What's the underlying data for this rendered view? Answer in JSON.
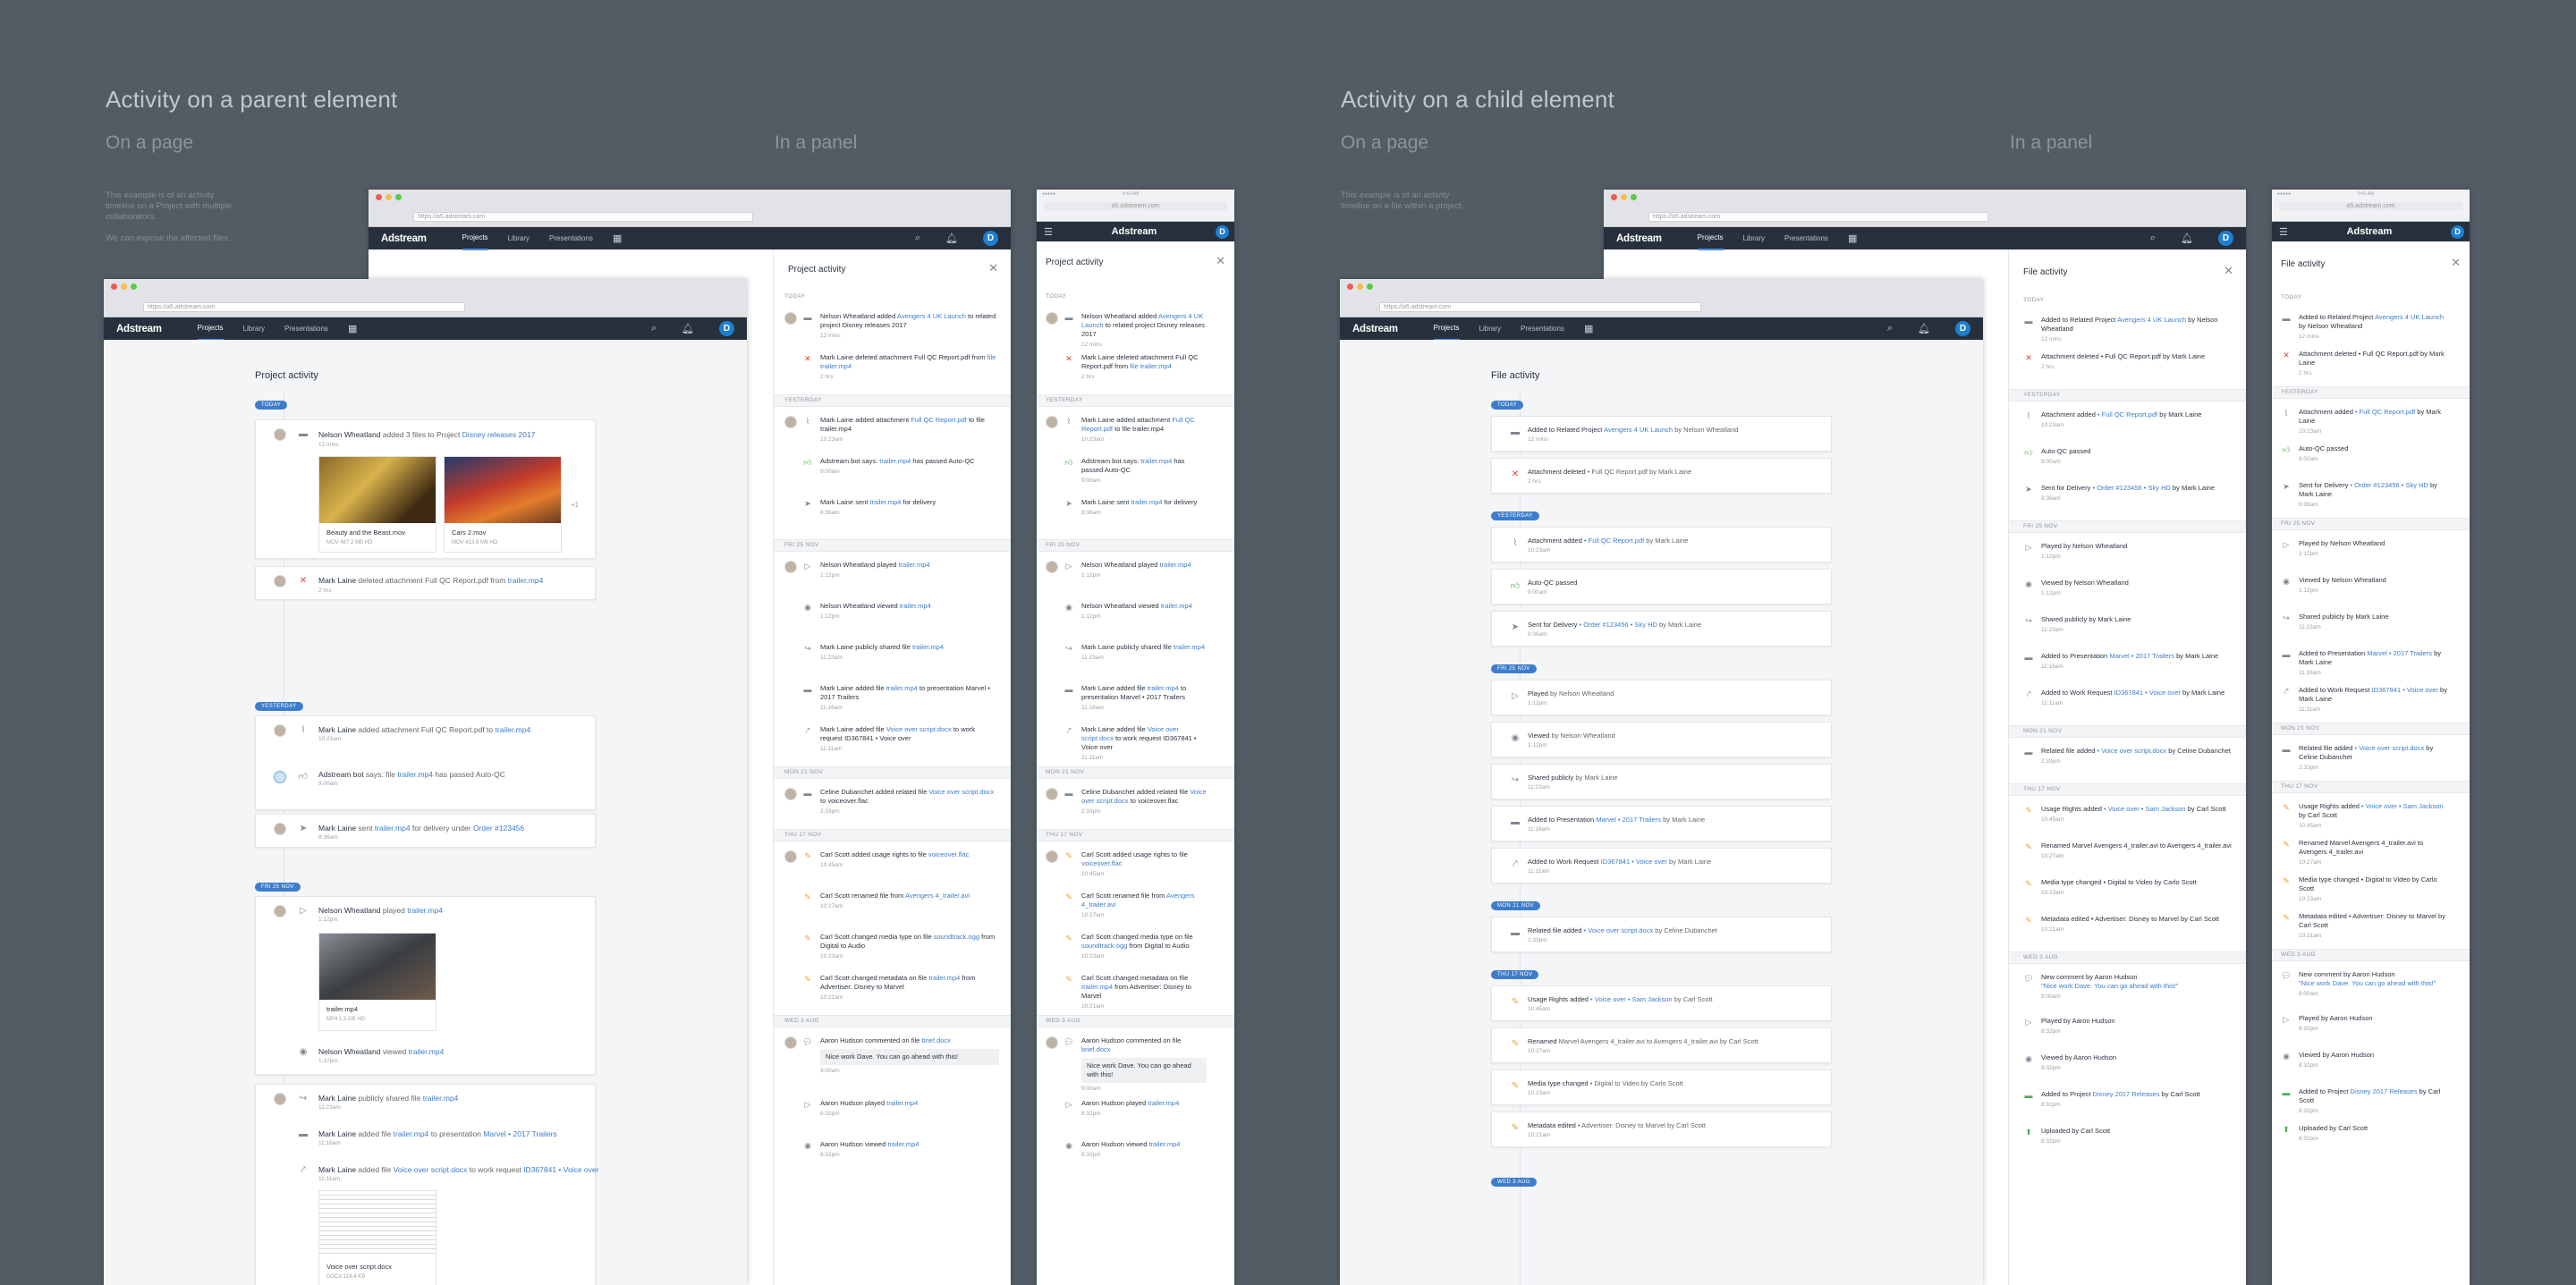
{
  "headings": {
    "parent": "Activity on a parent element",
    "child": "Activity on a child element",
    "on_page": "On a page",
    "in_panel": "In a panel"
  },
  "desc": {
    "parent_1": "This example is of an activity",
    "parent_2": "timeline on a Project with multiple",
    "parent_3": "collaborators.",
    "parent_4": "We can expose the affected files.",
    "child_1": "This example is of an activity",
    "child_2": "timeline on a file within a project."
  },
  "app": {
    "logo": "Adstream",
    "nav": [
      "Projects",
      "Library",
      "Presentations"
    ],
    "avatar_letter": "D",
    "url_desktop": "https://a5.adstream.com",
    "url_mobile": "a5.adstream.com",
    "mobile_time": "9:41 AM"
  },
  "pages": {
    "project_title": "Project activity",
    "file_title": "File activity"
  },
  "labels": {
    "today": "TODAY",
    "yesterday": "YESTERDAY",
    "fri": "FRI 25 NOV",
    "mon": "MON 21 NOV",
    "thu": "THU 17 NOV",
    "wed": "WED 3 AUG"
  },
  "parent_page": {
    "c1_user": "Nelson Wheatland",
    "c1_mid": " added 3 files to Project ",
    "c1_link": "Disney releases 2017",
    "c1_time": "12 mins",
    "thumb1_name": "Beauty and the Beast.mov",
    "thumb1_meta": "MOV   487.2 MB   HD",
    "thumb2_name": "Cars 2.mov",
    "thumb2_meta": "MOV   413.8 MB   HD",
    "more": "+1",
    "c2_user": "Mark Laine",
    "c2_mid": " deleted attachment Full QC Report.pdf from ",
    "c2_link": "trailer.mp4",
    "c2_time": "2 hrs",
    "y1_user": "Mark Laine",
    "y1_mid": " added attachment Full QC Report.pdf to ",
    "y1_link": "trailer.mp4",
    "y1_time": "10:23am",
    "y2_user": "Adstream bot",
    "y2_mid": " says: file ",
    "y2_link": "trailer.mp4",
    "y2_end": " has passed Auto-QC",
    "y2_time": "9:00am",
    "y3_user": "Mark Laine",
    "y3_mid": " sent ",
    "y3_link": "trailer.mp4",
    "y3_mid2": " for delivery under ",
    "y3_link2": "Order #123456",
    "y3_time": "8:36am",
    "f1_user": "Nelson Wheatland",
    "f1_mid": " played ",
    "f1_link": "trailer.mp4",
    "f1_time": "1:12pm",
    "f1_thumb_name": "trailer.mp4",
    "f1_thumb_meta": "MP4   1.3 GB   HD",
    "f2_user": "Nelson Wheatland",
    "f2_mid": " viewed ",
    "f2_link": "trailer.mp4",
    "f2_time": "1:12pm",
    "f3_user": "Mark Laine",
    "f3_mid": " publicly shared file ",
    "f3_link": "trailer.mp4",
    "f3_time": "11:23am",
    "f4_user": "Mark Laine",
    "f4_mid": " added file ",
    "f4_link": "trailer.mp4",
    "f4_mid2": " to presentation ",
    "f4_link2": "Marvel • 2017 Trailers",
    "f4_time": "11:16am",
    "f5_user": "Mark Laine",
    "f5_mid": " added file ",
    "f5_link": "Voice over script.docx",
    "f5_mid2": " to work request ",
    "f5_link2": "ID367841 • Voice over",
    "f5_time": "11:11am",
    "doc_name": "Voice over script.docx",
    "doc_meta": "DOCX   118.4 KB"
  },
  "parent_panel": {
    "items": [
      {
        "u": "Nelson Wheatland",
        "m": " added ",
        "l": "Avengers 4 UK Launch",
        "e": " to related project Disney releases 2017",
        "t": "12 mins"
      },
      {
        "u": "Mark Laine",
        "m": " deleted attachment Full QC Report.pdf from ",
        "l": "file trailer.mp4",
        "e": "",
        "t": "2 hrs"
      },
      {
        "u": "Mark Laine",
        "m": " added attachment ",
        "l": "Full QC Report.pdf",
        "e": " to file trailer.mp4",
        "t": "10:23am"
      },
      {
        "u": "Adstream bot",
        "m": " says: ",
        "l": "trailer.mp4",
        "e": " has passed Auto-QC",
        "t": "9:00am"
      },
      {
        "u": "Mark Laine",
        "m": " sent ",
        "l": "trailer.mp4",
        "e": " for delivery",
        "t": "8:36am"
      },
      {
        "u": "Nelson Wheatland",
        "m": " played ",
        "l": "trailer.mp4",
        "e": "",
        "t": "1:12pm"
      },
      {
        "u": "Nelson Wheatland",
        "m": " viewed ",
        "l": "trailer.mp4",
        "e": "",
        "t": "1:12pm"
      },
      {
        "u": "Mark Laine",
        "m": " publicly shared file ",
        "l": "trailer.mp4",
        "e": "",
        "t": "11:23am"
      },
      {
        "u": "Mark Laine",
        "m": " added file ",
        "l": "trailer.mp4",
        "e": " to presentation Marvel • 2017 Trailers",
        "t": "11:16am"
      },
      {
        "u": "Mark Laine",
        "m": " added file ",
        "l": "Voice over script.docx",
        "e": " to work request ID367841 • Voice over",
        "t": "11:11am"
      },
      {
        "u": "Celine Dubanchet",
        "m": " added related file ",
        "l": "Voice over script.docx",
        "e": " to voiceover.flac",
        "t": "2:33pm"
      },
      {
        "u": "Carl Scott",
        "m": " added usage rights to file ",
        "l": "voiceover.flac",
        "e": "",
        "t": "10:45am"
      },
      {
        "u": "Carl Scott",
        "m": " renamed file from ",
        "l": "Avengers 4_trailer.avi",
        "e": "",
        "t": "10:27am"
      },
      {
        "u": "Carl Scott",
        "m": " changed media type on file ",
        "l": "soundtrack.ogg",
        "e": " from Digital to Audio",
        "t": "10:23am"
      },
      {
        "u": "Carl Scott",
        "m": " changed metadata on file ",
        "l": "trailer.mp4",
        "e": " from Advertiser: Disney to Marvel",
        "t": "10:21am"
      },
      {
        "u": "Aaron Hudson",
        "m": " commented on file ",
        "l": "brief.docx",
        "e": "",
        "t": "9:00am"
      },
      {
        "u": "Aaron Hudson",
        "m": " played ",
        "l": "trailer.mp4",
        "e": "",
        "t": "8:32pm"
      },
      {
        "u": "Aaron Hudson",
        "m": " viewed ",
        "l": "trailer.mp4",
        "e": "",
        "t": "8:32pm"
      }
    ],
    "comment": "Nice work Dave. You can go ahead with this!"
  },
  "child_page": {
    "items": [
      {
        "a": "Added to Related Project ",
        "l": "Avengers 4 UK Launch",
        "e": " by Nelson Wheatland",
        "t": "12 mins"
      },
      {
        "a": "Attachment deleted",
        "l": "",
        "e": " • Full QC Report.pdf by Mark Laine",
        "t": "2 hrs"
      },
      {
        "a": "Attachment added",
        "l": " • Full QC Report.pdf",
        "e": " by Mark Laine",
        "t": "10:23am"
      },
      {
        "a": "Auto-QC passed",
        "l": "",
        "e": "",
        "t": "9:00am"
      },
      {
        "a": "Sent for Delivery",
        "l": " • Order #123456 • Sky HD",
        "e": " by Mark Laine",
        "t": "8:36am"
      },
      {
        "a": "Played",
        "l": "",
        "e": " by Nelson Wheatland",
        "t": "1:12pm"
      },
      {
        "a": "Viewed",
        "l": "",
        "e": " by Nelson Wheatland",
        "t": "1:12pm"
      },
      {
        "a": "Shared publicly",
        "l": "",
        "e": " by Mark Laine",
        "t": "11:23am"
      },
      {
        "a": "Added to Presentation",
        "l": " Marvel • 2017 Trailers",
        "e": " by Mark Laine",
        "t": "11:16am"
      },
      {
        "a": "Added to Work Request",
        "l": " ID367841 • Voice over",
        "e": " by Mark Laine",
        "t": "11:11am"
      },
      {
        "a": "Related file added",
        "l": " • Voice over script.docx",
        "e": " by Celine Dubanchet",
        "t": "2:33pm"
      },
      {
        "a": "Usage Rights added",
        "l": " • Voice over • Sam Jackson",
        "e": " by Carl Scott",
        "t": "10:45am"
      },
      {
        "a": "Renamed",
        "l": "",
        "e": " Marvel Avengers 4_trailer.avi to Avengers 4_trailer.avi by Carl Scott",
        "t": "10:27am"
      },
      {
        "a": "Media type changed",
        "l": "",
        "e": " • Digital to Video by Carlo Scott",
        "t": "10:23am"
      },
      {
        "a": "Metadata edited",
        "l": "",
        "e": " • Advertiser: Disney to Marvel by Carl Scott",
        "t": "10:21am"
      }
    ]
  },
  "child_panel": {
    "items": [
      {
        "a": "Added to Related Project ",
        "l": "Avengers 4 UK Launch",
        "e": " by Nelson Wheatland",
        "t": "12 mins"
      },
      {
        "a": "Attachment deleted",
        "l": "",
        "e": " • Full QC Report.pdf by Mark Laine",
        "t": "2 hrs"
      },
      {
        "a": "Attachment added",
        "l": " • Full QC Report.pdf",
        "e": " by Mark Laine",
        "t": "10:23am"
      },
      {
        "a": "Auto-QC passed",
        "l": "",
        "e": "",
        "t": "9:00am"
      },
      {
        "a": "Sent for Delivery",
        "l": " • Order #123456 • Sky HD",
        "e": " by Mark Laine",
        "t": "8:36am"
      },
      {
        "a": "Played",
        "l": "",
        "e": " by Nelson Wheatland",
        "t": "1:12pm"
      },
      {
        "a": "Viewed",
        "l": "",
        "e": " by Nelson Wheatland",
        "t": "1:12pm"
      },
      {
        "a": "Shared publicly",
        "l": "",
        "e": " by Mark Laine",
        "t": "11:23am"
      },
      {
        "a": "Added to Presentation",
        "l": " Marvel • 2017 Trailers",
        "e": " by Mark Laine",
        "t": "11:16am"
      },
      {
        "a": "Added to Work Request",
        "l": " ID367841 • Voice over",
        "e": " by Mark Laine",
        "t": "11:11am"
      },
      {
        "a": "Related file added",
        "l": " • Voice over script.docx",
        "e": " by Celine Dubanchet",
        "t": "2:33pm"
      },
      {
        "a": "Usage Rights added",
        "l": " • Voice over • Sam Jackson",
        "e": " by Carl Scott",
        "t": "10:45am"
      },
      {
        "a": "Renamed",
        "l": "",
        "e": " Marvel Avengers 4_trailer.avi to Avengers 4_trailer.avi",
        "t": "10:27am"
      },
      {
        "a": "Media type changed",
        "l": "",
        "e": " • Digital to Video by Carlo Scott",
        "t": "10:23am"
      },
      {
        "a": "Metadata edited",
        "l": "",
        "e": " • Advertiser: Disney to Marvel by Carl Scott",
        "t": "10:21am"
      },
      {
        "a": "New comment",
        "l": "",
        "e": " by Aaron Hudson",
        "t": "9:00am"
      },
      {
        "a": "Played",
        "l": "",
        "e": " by Aaron Hudson",
        "t": "8:32pm"
      },
      {
        "a": "Viewed",
        "l": "",
        "e": " by Aaron Hudson",
        "t": "8:32pm"
      },
      {
        "a": "Added to Project",
        "l": " Disney 2017 Releases",
        "e": " by Carl Scott",
        "t": "8:32pm"
      },
      {
        "a": "Uploaded",
        "l": "",
        "e": " by Carl Scott",
        "t": "8:32pm"
      }
    ],
    "comment": "Nice work Dave. You can go ahead with this!"
  }
}
